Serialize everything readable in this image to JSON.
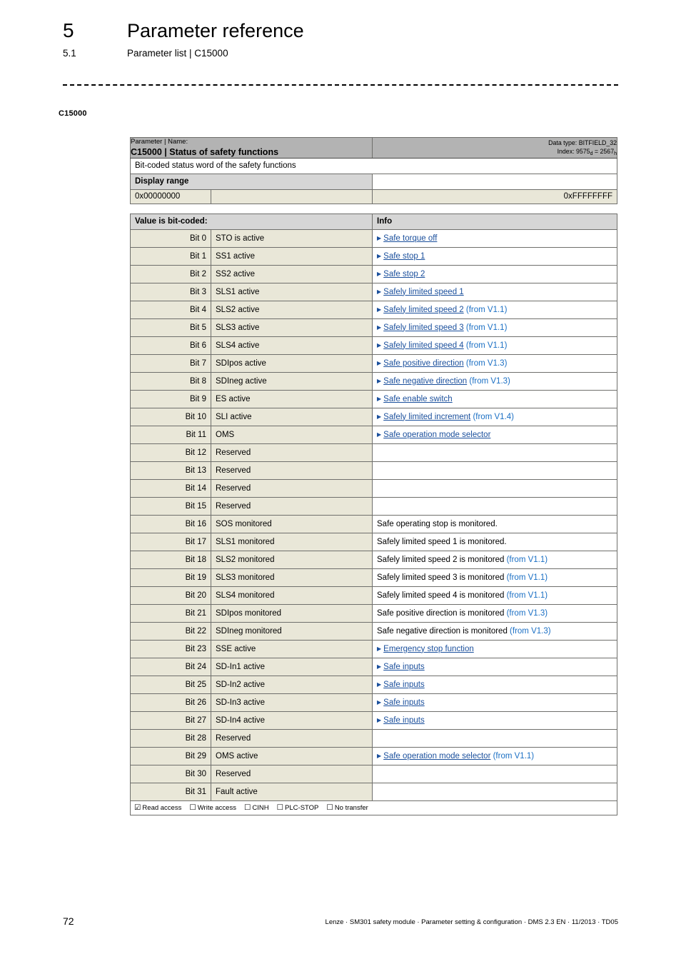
{
  "header": {
    "chapter_number": "5",
    "chapter_title": "Parameter reference",
    "section_number": "5.1",
    "section_title": "Parameter list | C15000"
  },
  "margin_label": "C15000",
  "table": {
    "title_kicker": "Parameter | Name:",
    "title_main": "C15000 | Status of safety functions",
    "data_type_label": "Data type: BITFIELD_32",
    "index_prefix": "Index: ",
    "index_dec": "9575",
    "index_dec_sub": "d",
    "index_eq": " = ",
    "index_hex": "2567",
    "index_hex_sub": "h",
    "description": "Bit-coded status word of the safety functions",
    "display_range_label": "Display range",
    "range_min": "0x00000000",
    "range_mid": "",
    "range_max": "0xFFFFFFFF",
    "bitcoded_label": "Value is bit-coded:",
    "info_label": "Info",
    "rows": [
      {
        "bit": "Bit 0",
        "name": "STO is active",
        "link": "Safe torque off",
        "suffix": "",
        "plain": ""
      },
      {
        "bit": "Bit 1",
        "name": "SS1 active",
        "link": "Safe stop 1",
        "suffix": "",
        "plain": ""
      },
      {
        "bit": "Bit 2",
        "name": "SS2 active",
        "link": "Safe stop 2",
        "suffix": "",
        "plain": ""
      },
      {
        "bit": "Bit 3",
        "name": "SLS1 active",
        "link": "Safely limited speed 1",
        "suffix": "",
        "plain": ""
      },
      {
        "bit": "Bit 4",
        "name": "SLS2 active",
        "link": "Safely limited speed 2",
        "suffix": "(from V1.1)",
        "plain": ""
      },
      {
        "bit": "Bit 5",
        "name": "SLS3 active",
        "link": "Safely limited speed 3",
        "suffix": "(from V1.1)",
        "plain": ""
      },
      {
        "bit": "Bit 6",
        "name": "SLS4 active",
        "link": "Safely limited speed 4",
        "suffix": "(from V1.1)",
        "plain": ""
      },
      {
        "bit": "Bit 7",
        "name": "SDIpos active",
        "link": "Safe positive direction",
        "suffix": "(from V1.3)",
        "plain": ""
      },
      {
        "bit": "Bit 8",
        "name": "SDIneg active",
        "link": "Safe negative direction",
        "suffix": "(from V1.3)",
        "plain": ""
      },
      {
        "bit": "Bit 9",
        "name": "ES active",
        "link": "Safe enable switch",
        "suffix": "",
        "plain": ""
      },
      {
        "bit": "Bit 10",
        "name": "SLI active",
        "link": "Safely limited increment",
        "suffix": "(from V1.4)",
        "plain": ""
      },
      {
        "bit": "Bit 11",
        "name": "OMS",
        "link": "Safe operation mode selector",
        "suffix": "",
        "plain": ""
      },
      {
        "bit": "Bit 12",
        "name": "Reserved",
        "link": "",
        "suffix": "",
        "plain": ""
      },
      {
        "bit": "Bit 13",
        "name": "Reserved",
        "link": "",
        "suffix": "",
        "plain": ""
      },
      {
        "bit": "Bit 14",
        "name": "Reserved",
        "link": "",
        "suffix": "",
        "plain": ""
      },
      {
        "bit": "Bit 15",
        "name": "Reserved",
        "link": "",
        "suffix": "",
        "plain": ""
      },
      {
        "bit": "Bit 16",
        "name": "SOS monitored",
        "link": "",
        "suffix": "",
        "plain": "Safe operating stop is monitored."
      },
      {
        "bit": "Bit 17",
        "name": "SLS1 monitored",
        "link": "",
        "suffix": "",
        "plain": "Safely limited speed 1 is monitored."
      },
      {
        "bit": "Bit 18",
        "name": "SLS2 monitored",
        "link": "",
        "suffix": "(from V1.1)",
        "plain": "Safely limited speed 2 is monitored "
      },
      {
        "bit": "Bit 19",
        "name": "SLS3 monitored",
        "link": "",
        "suffix": "(from V1.1)",
        "plain": "Safely limited speed 3 is monitored "
      },
      {
        "bit": "Bit 20",
        "name": "SLS4 monitored",
        "link": "",
        "suffix": "(from V1.1)",
        "plain": "Safely limited speed 4 is monitored "
      },
      {
        "bit": "Bit 21",
        "name": "SDIpos monitored",
        "link": "",
        "suffix": "(from V1.3)",
        "plain": "Safe positive direction is monitored "
      },
      {
        "bit": "Bit 22",
        "name": "SDIneg monitored",
        "link": "",
        "suffix": "(from V1.3)",
        "plain": "Safe negative direction is monitored "
      },
      {
        "bit": "Bit 23",
        "name": "SSE active",
        "link": "Emergency stop function",
        "suffix": "",
        "plain": ""
      },
      {
        "bit": "Bit 24",
        "name": "SD-In1 active",
        "link": "Safe inputs",
        "suffix": "",
        "plain": ""
      },
      {
        "bit": "Bit 25",
        "name": "SD-In2 active",
        "link": "Safe inputs",
        "suffix": "",
        "plain": ""
      },
      {
        "bit": "Bit 26",
        "name": "SD-In3 active",
        "link": "Safe inputs",
        "suffix": "",
        "plain": ""
      },
      {
        "bit": "Bit 27",
        "name": "SD-In4 active",
        "link": "Safe inputs",
        "suffix": "",
        "plain": ""
      },
      {
        "bit": "Bit 28",
        "name": "Reserved",
        "link": "",
        "suffix": "",
        "plain": ""
      },
      {
        "bit": "Bit 29",
        "name": "OMS active",
        "link": "Safe operation mode selector",
        "suffix": "(from V1.1)",
        "plain": ""
      },
      {
        "bit": "Bit 30",
        "name": "Reserved",
        "link": "",
        "suffix": "",
        "plain": ""
      },
      {
        "bit": "Bit 31",
        "name": "Fault active",
        "link": "",
        "suffix": "",
        "plain": ""
      }
    ],
    "access": [
      {
        "label": "Read access",
        "checked": true,
        "box": "☑"
      },
      {
        "label": "Write access",
        "checked": false,
        "box": "☐"
      },
      {
        "label": "CINH",
        "checked": false,
        "box": "☐"
      },
      {
        "label": "PLC-STOP",
        "checked": false,
        "box": "☐"
      },
      {
        "label": "No transfer",
        "checked": false,
        "box": "☐"
      }
    ]
  },
  "footer": {
    "page_number": "72",
    "imprint": "Lenze · SM301 safety module · Parameter setting & configuration · DMS 2.3 EN · 11/2013 · TD05"
  },
  "colors": {
    "title_band": "#b3b3b3",
    "subhead": "#d6d6d6",
    "row_beige": "#e9e7d8",
    "link_blue": "#1a4f9c",
    "version_blue": "#1a6fc4"
  }
}
